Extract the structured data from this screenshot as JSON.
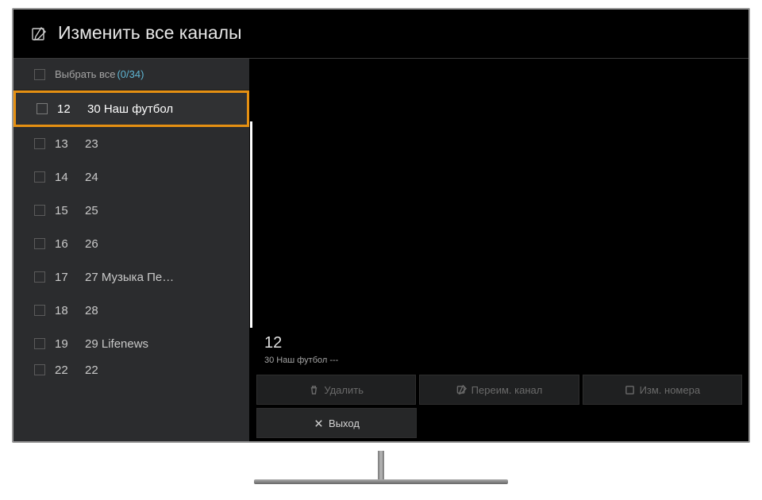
{
  "title": "Изменить все каналы",
  "select_all": {
    "label": "Выбрать все",
    "count": "(0/34)"
  },
  "channels": [
    {
      "num": "12",
      "name": "30 Наш футбол",
      "selected": true
    },
    {
      "num": "13",
      "name": "23"
    },
    {
      "num": "14",
      "name": "24"
    },
    {
      "num": "15",
      "name": "25"
    },
    {
      "num": "16",
      "name": "26"
    },
    {
      "num": "17",
      "name": "27 Музыка Пе…"
    },
    {
      "num": "18",
      "name": "28"
    },
    {
      "num": "19",
      "name": "29 Lifenews"
    },
    {
      "num": "22",
      "name": "22"
    }
  ],
  "detail": {
    "num": "12",
    "name": "30 Наш футбол  ---"
  },
  "buttons": {
    "delete": "Удалить",
    "rename": "Переим. канал",
    "renumber": "Изм. номера",
    "exit": "Выход"
  }
}
